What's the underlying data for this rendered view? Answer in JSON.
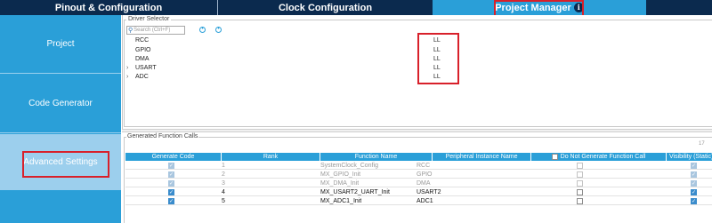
{
  "tabs": [
    {
      "label": "Pinout & Configuration"
    },
    {
      "label": "Clock Configuration"
    },
    {
      "label": "Project Manager",
      "info": "i"
    }
  ],
  "sidebar": {
    "items": [
      {
        "label": "Project"
      },
      {
        "label": "Code Generator"
      },
      {
        "label": "Advanced Settings",
        "active": true
      }
    ]
  },
  "driver_selector": {
    "legend": "Driver Selector",
    "search_placeholder": "Search (Ctrl+F)",
    "drivers": [
      {
        "name": "RCC",
        "value": "LL",
        "expandable": false
      },
      {
        "name": "GPIO",
        "value": "LL",
        "expandable": false
      },
      {
        "name": "DMA",
        "value": "LL",
        "expandable": false
      },
      {
        "name": "USART",
        "value": "LL",
        "expandable": true
      },
      {
        "name": "ADC",
        "value": "LL",
        "expandable": true
      }
    ]
  },
  "function_calls": {
    "legend": "Generated Function Calls",
    "count_hint": "17",
    "columns": [
      "Generate Code",
      "Rank",
      "Function Name",
      "Peripheral Instance Name",
      "Do Not Generate Function Call",
      "Visibility (Static)"
    ],
    "rows": [
      {
        "generate": true,
        "rank": "1",
        "function": "SystemClock_Config",
        "instance": "RCC",
        "no_call": false,
        "visibility": true,
        "enabled": false
      },
      {
        "generate": true,
        "rank": "2",
        "function": "MX_GPIO_Init",
        "instance": "GPIO",
        "no_call": false,
        "visibility": true,
        "enabled": false
      },
      {
        "generate": true,
        "rank": "3",
        "function": "MX_DMA_Init",
        "instance": "DMA",
        "no_call": false,
        "visibility": true,
        "enabled": false
      },
      {
        "generate": true,
        "rank": "4",
        "function": "MX_USART2_UART_Init",
        "instance": "USART2",
        "no_call": false,
        "visibility": true,
        "enabled": true
      },
      {
        "generate": true,
        "rank": "5",
        "function": "MX_ADC1_Init",
        "instance": "ADC1",
        "no_call": false,
        "visibility": true,
        "enabled": true
      }
    ]
  },
  "colors": {
    "tabbar_bg": "#0b2a4e",
    "accent_blue": "#2a9fd8",
    "active_sidebar": "#9ccfed",
    "highlight_red": "#d8202a"
  }
}
